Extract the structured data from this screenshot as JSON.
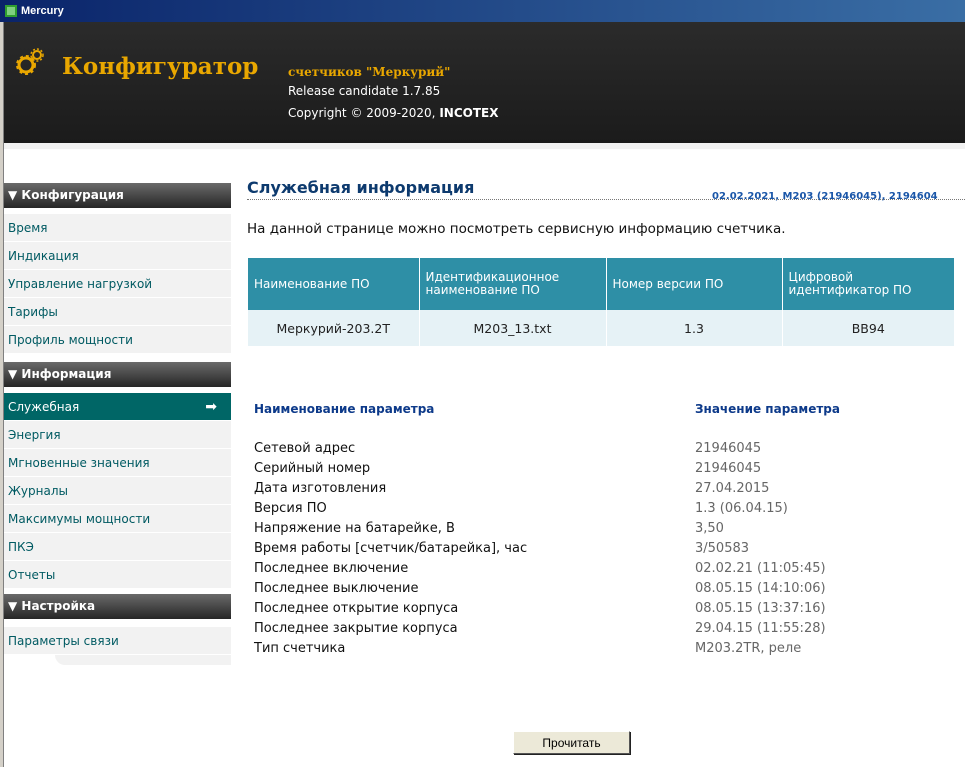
{
  "window": {
    "title": "Mercury"
  },
  "header": {
    "brand": "Конфигуратор",
    "subtitle": "счетчиков \"Меркурий\"",
    "release": "Release candidate 1.7.85",
    "copyright_prefix": "Copyright © 2009-2020, ",
    "copyright_company": "INCOTEX"
  },
  "sidebar": {
    "sections": [
      {
        "title": "▼ Конфигурация",
        "items": [
          "Время",
          "Индикация",
          "Управление нагрузкой",
          "Тарифы",
          "Профиль мощности"
        ]
      },
      {
        "title": "▼ Информация",
        "items": [
          "Служебная",
          "Энергия",
          "Мгновенные значения",
          "Журналы",
          "Максимумы мощности",
          "ПКЭ",
          "Отчеты"
        ]
      },
      {
        "title": "▼ Настройка",
        "items": [
          "Параметры связи"
        ]
      }
    ],
    "active_item": "Служебная"
  },
  "main": {
    "title": "Служебная информация",
    "meter_info": "02.02.2021, M203 (21946045), 2194604",
    "intro": "На данной странице можно посмотреть сервисную информацию счетчика.",
    "software_table": {
      "headers": [
        "Наименование ПО",
        "Идентификационное наименование ПО",
        "Номер версии ПО",
        "Цифровой идентификатор ПО"
      ],
      "rows": [
        [
          "Меркурий-203.2Т",
          "M203_13.txt",
          "1.3",
          "BB94"
        ]
      ]
    },
    "params_header": {
      "name": "Наименование параметра",
      "value": "Значение параметра"
    },
    "params": [
      {
        "name": "Сетевой адрес",
        "value": "21946045"
      },
      {
        "name": "Серийный номер",
        "value": "21946045"
      },
      {
        "name": "Дата изготовления",
        "value": "27.04.2015"
      },
      {
        "name": "Версия ПО",
        "value": "1.3 (06.04.15)"
      },
      {
        "name": "Напряжение на батарейке, В",
        "value": "3,50"
      },
      {
        "name": "Время работы [счетчик/батарейка], час",
        "value": "3/50583"
      },
      {
        "name": "Последнее включение",
        "value": "02.02.21 (11:05:45)"
      },
      {
        "name": "Последнее выключение",
        "value": "08.05.15 (14:10:06)"
      },
      {
        "name": "Последнее открытие корпуса",
        "value": "08.05.15 (13:37:16)"
      },
      {
        "name": "Последнее закрытие корпуса",
        "value": "29.04.15 (11:55:28)"
      },
      {
        "name": "Тип счетчика",
        "value": "M203.2TR, реле"
      }
    ],
    "read_button": "Прочитать"
  },
  "colors": {
    "accent": "#006666",
    "brand": "#e9a700",
    "table_header": "#2e8fa6",
    "link": "#005a62"
  }
}
